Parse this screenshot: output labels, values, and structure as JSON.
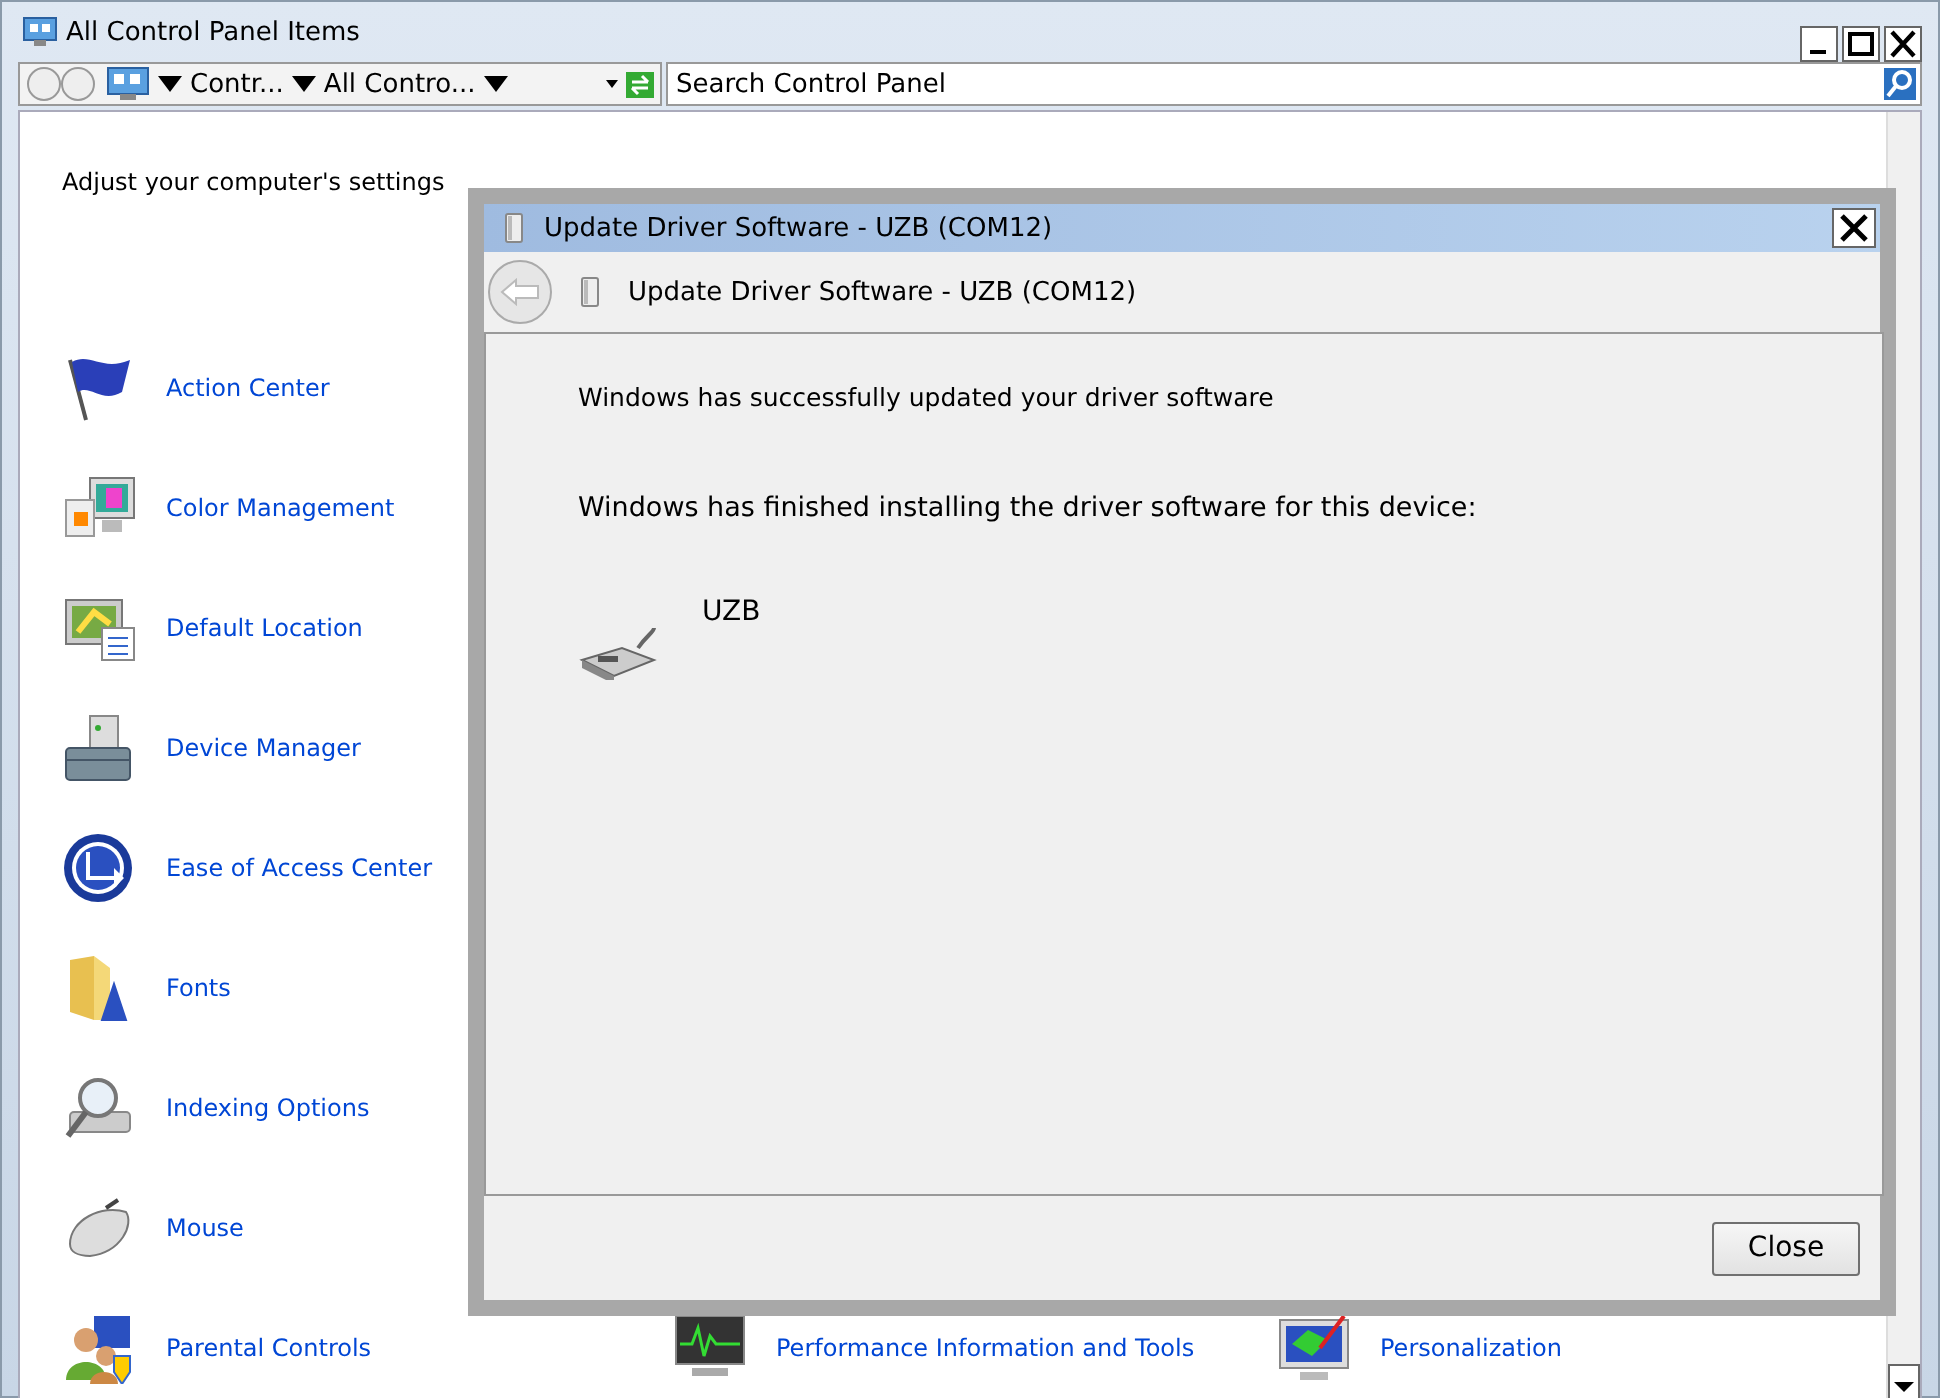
{
  "window": {
    "title": "All Control Panel Items"
  },
  "address_bar": {
    "breadcrumbs": [
      "Contr...",
      "All Contro..."
    ],
    "search": {
      "placeholder": "Search Control Panel"
    }
  },
  "heading": "Adjust your computer's settings",
  "columns": [
    [
      {
        "label": "Action Center"
      },
      {
        "label": "Color Management"
      },
      {
        "label": "Default Location"
      },
      {
        "label": "Device Manager"
      },
      {
        "label": "Ease of Access Center"
      },
      {
        "label": "Fonts"
      },
      {
        "label": "Indexing Options"
      },
      {
        "label": "Mouse"
      },
      {
        "label": "Parental Controls"
      }
    ],
    [
      {
        "label": "Performance Information and Tools"
      }
    ],
    [
      {
        "label": "Personalization"
      }
    ]
  ],
  "dialog": {
    "title": "Update Driver Software - UZB (COM12)",
    "header": "Update Driver Software - UZB (COM12)",
    "message": "Windows has successfully updated your driver software",
    "detail": "Windows has finished installing the driver software for this device:",
    "device": "UZB",
    "buttons": [
      "Close"
    ]
  }
}
